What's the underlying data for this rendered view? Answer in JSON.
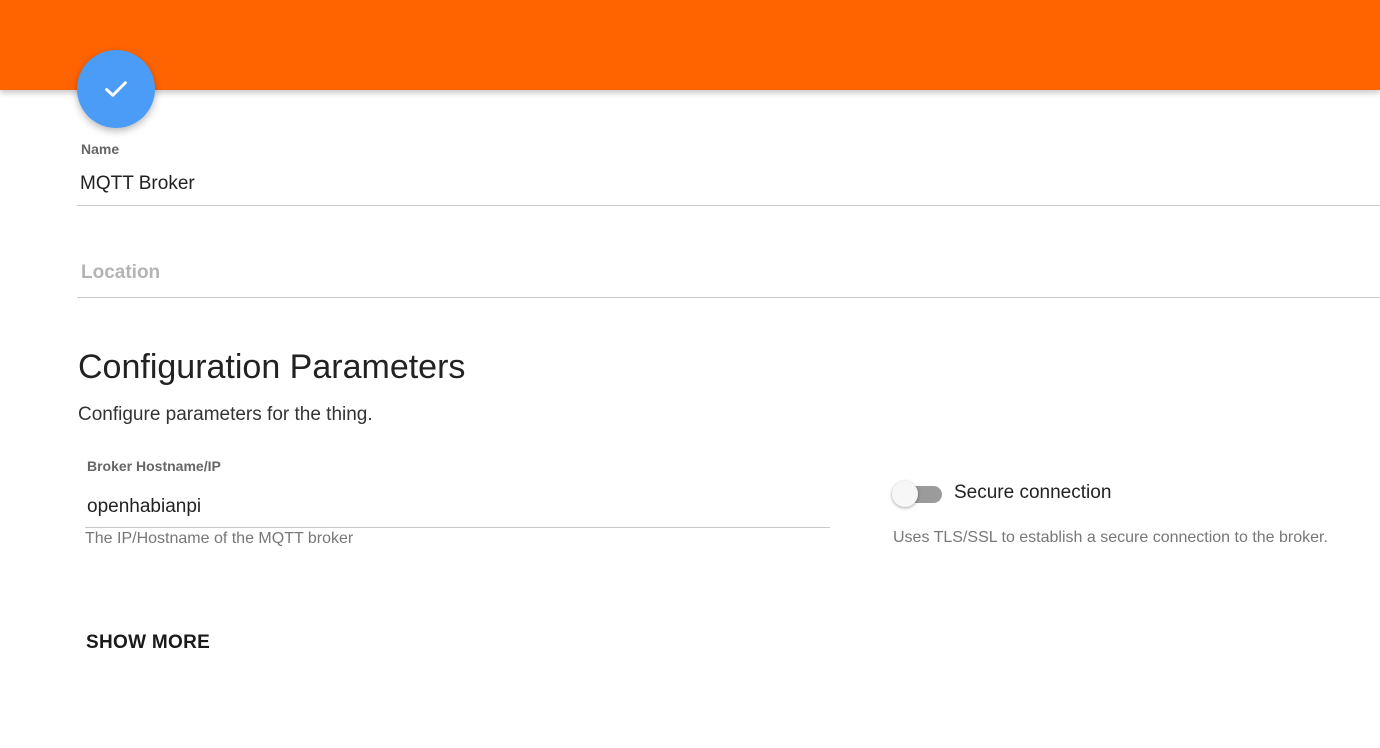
{
  "header": {
    "accent_color": "#ff6400",
    "save_button_icon": "check-icon",
    "save_button_color": "#4a9cf6"
  },
  "name_field": {
    "label": "Name",
    "value": "MQTT Broker"
  },
  "location_field": {
    "placeholder": "Location",
    "value": ""
  },
  "config": {
    "title": "Configuration Parameters",
    "description": "Configure parameters for the thing."
  },
  "broker_field": {
    "label": "Broker Hostname/IP",
    "value": "openhabianpi",
    "hint": "The IP/Hostname of the MQTT broker"
  },
  "secure_toggle": {
    "label": "Secure connection",
    "state": "off",
    "hint": "Uses TLS/SSL to establish a secure connection to the broker."
  },
  "actions": {
    "show_more_label": "SHOW MORE"
  }
}
